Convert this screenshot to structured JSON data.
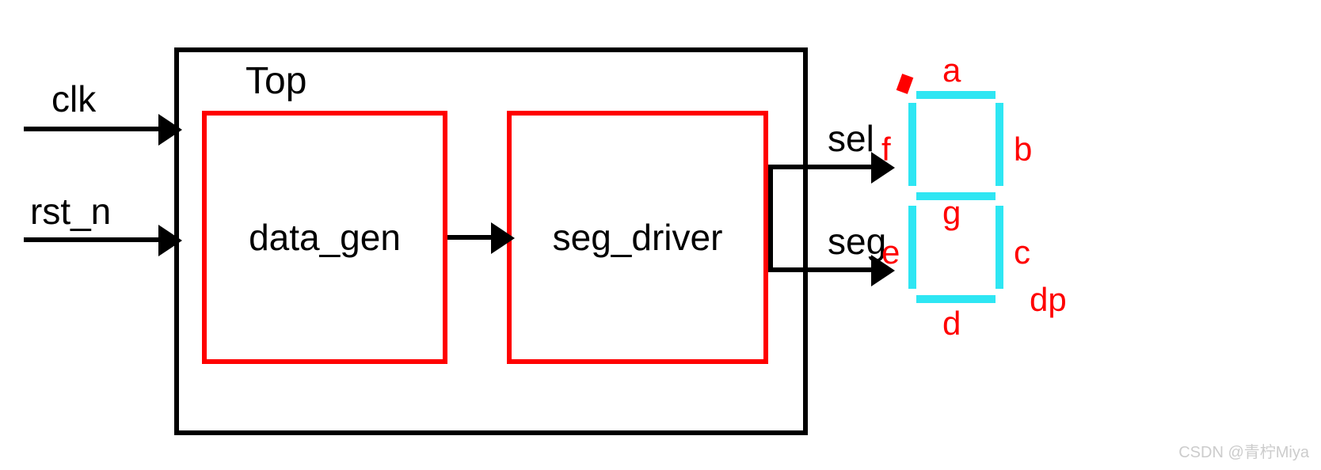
{
  "diagram": {
    "top_label": "Top",
    "inputs": {
      "clk": "clk",
      "rst_n": "rst_n"
    },
    "modules": {
      "data_gen": "data_gen",
      "seg_driver": "seg_driver"
    },
    "outputs": {
      "sel": "sel",
      "seg": "seg"
    }
  },
  "seven_segment": {
    "segments": {
      "a": "a",
      "b": "b",
      "c": "c",
      "d": "d",
      "e": "e",
      "f": "f",
      "g": "g",
      "dp": "dp"
    }
  },
  "watermark": "CSDN @青柠Miya"
}
